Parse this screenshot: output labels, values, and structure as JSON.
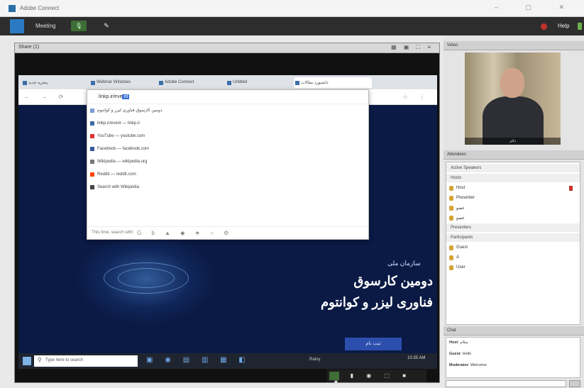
{
  "window": {
    "title": "Adobe Connect"
  },
  "meetbar": {
    "menu": "Meeting",
    "help": "Help"
  },
  "sharepod": {
    "title": "Share (1)",
    "browser": {
      "tabs": [
        "پنجره جدید",
        "Webinar Windows",
        "Adobe Connect",
        "Untitled",
        "داشبورد مقالات"
      ],
      "url_text": "linkp.ir/eve",
      "url_selected": "nt",
      "suggestions": [
        "دومین کارسوق فناوری لیزر و کوانتوم",
        "linkp.ir/event — linkp.ir",
        "YouTube — youtube.com",
        "Facebook — facebook.com",
        "Wikipedia — wikipedia.org",
        "Reddit — reddit.com",
        "Search with Wikipedia"
      ],
      "footer_label": "This time, search with:"
    },
    "slide": {
      "org": "سازمان ملی",
      "title_line1": "دومین کارسوق",
      "title_line2": "فناوری لیزر و کوانتوم",
      "button": "ثبت نام"
    },
    "taskbar": {
      "search_placeholder": "Type here to search",
      "tray": "Rainy",
      "time": "10:35 AM"
    }
  },
  "rightcol": {
    "camera_pod": "Video",
    "camera_caption": "دکتر",
    "attendees_pod": "Attendees",
    "attendees": [
      {
        "label": "Active Speakers",
        "group": true
      },
      {
        "label": "Hosts",
        "group": true
      },
      {
        "label": "Host",
        "group": false,
        "mic": true
      },
      {
        "label": "Presenter",
        "group": false,
        "mic": false
      },
      {
        "label": "عضو",
        "group": false,
        "mic": false
      },
      {
        "label": "عضو",
        "group": false,
        "mic": false
      },
      {
        "label": "Presenters",
        "group": true
      },
      {
        "label": "Participants",
        "group": true
      },
      {
        "label": "Guest",
        "group": false,
        "mic": false
      },
      {
        "label": "A",
        "group": false,
        "mic": false
      },
      {
        "label": "User",
        "group": false,
        "mic": false
      }
    ],
    "chat_pod": "Chat",
    "chat": [
      {
        "name": "Host",
        "text": "سلام"
      },
      {
        "name": "Guest",
        "text": "Hello"
      },
      {
        "name": "Moderator",
        "text": "Welcome"
      }
    ]
  },
  "colors": {
    "slide_bg": "#0b1a45",
    "accent": "#2b79c2",
    "record": "#c0332b"
  }
}
